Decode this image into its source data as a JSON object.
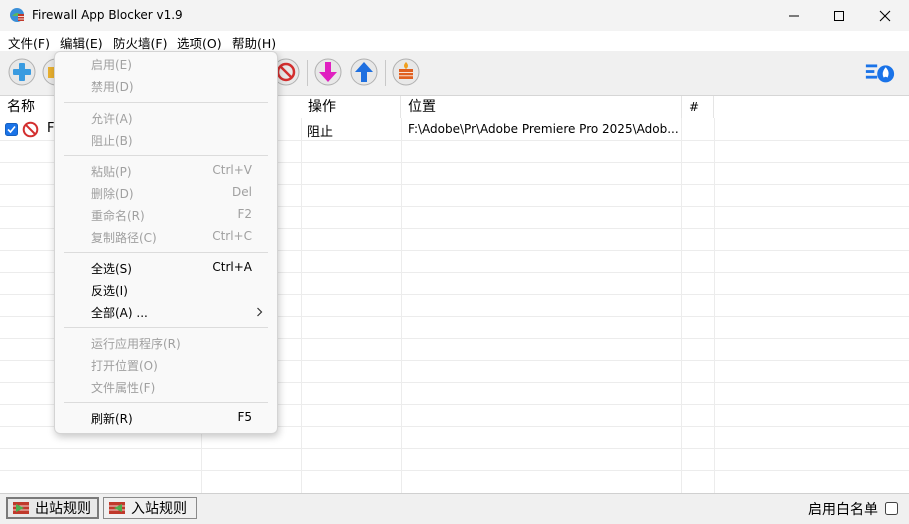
{
  "window": {
    "title": "Firewall App Blocker v1.9"
  },
  "menubar": {
    "file": "文件(F)",
    "edit": "编辑(E)",
    "firewall": "防火墙(F)",
    "options": "选项(O)",
    "help": "帮助(H)"
  },
  "list": {
    "columns": {
      "name": "名称",
      "action": "操作",
      "location": "位置",
      "num": "#"
    },
    "rows": [
      {
        "checked": true,
        "name_visible": "F",
        "action": "阻止",
        "location": "F:\\Adobe\\Pr\\Adobe Premiere Pro 2025\\Adob..."
      }
    ]
  },
  "edit_menu": {
    "enable": {
      "label": "启用(E)",
      "enabled": false
    },
    "disable": {
      "label": "禁用(D)",
      "enabled": false
    },
    "allow": {
      "label": "允许(A)",
      "enabled": false
    },
    "block": {
      "label": "阻止(B)",
      "enabled": false
    },
    "paste": {
      "label": "粘贴(P)",
      "shortcut": "Ctrl+V",
      "enabled": false
    },
    "delete": {
      "label": "删除(D)",
      "shortcut": "Del",
      "enabled": false
    },
    "rename": {
      "label": "重命名(R)",
      "shortcut": "F2",
      "enabled": false
    },
    "copy_path": {
      "label": "复制路径(C)",
      "shortcut": "Ctrl+C",
      "enabled": false
    },
    "select_all": {
      "label": "全选(S)",
      "shortcut": "Ctrl+A",
      "enabled": true
    },
    "invert": {
      "label": "反选(I)",
      "enabled": true
    },
    "all": {
      "label": "全部(A) ...",
      "submenu": true,
      "enabled": true
    },
    "run_app": {
      "label": "运行应用程序(R)",
      "enabled": false
    },
    "open_location": {
      "label": "打开位置(O)",
      "enabled": false
    },
    "file_props": {
      "label": "文件属性(F)",
      "enabled": false
    },
    "refresh": {
      "label": "刷新(R)",
      "shortcut": "F5",
      "enabled": true
    }
  },
  "status": {
    "outbound": "出站规则",
    "inbound": "入站规则",
    "whitelist": "启用白名单",
    "whitelist_checked": false
  },
  "colors": {
    "accent_blue": "#1a73e8",
    "block_red": "#d32f2f",
    "download_magenta": "#e020c0",
    "upload_blue": "#1e6fe0",
    "wall_orange": "#e06020"
  }
}
